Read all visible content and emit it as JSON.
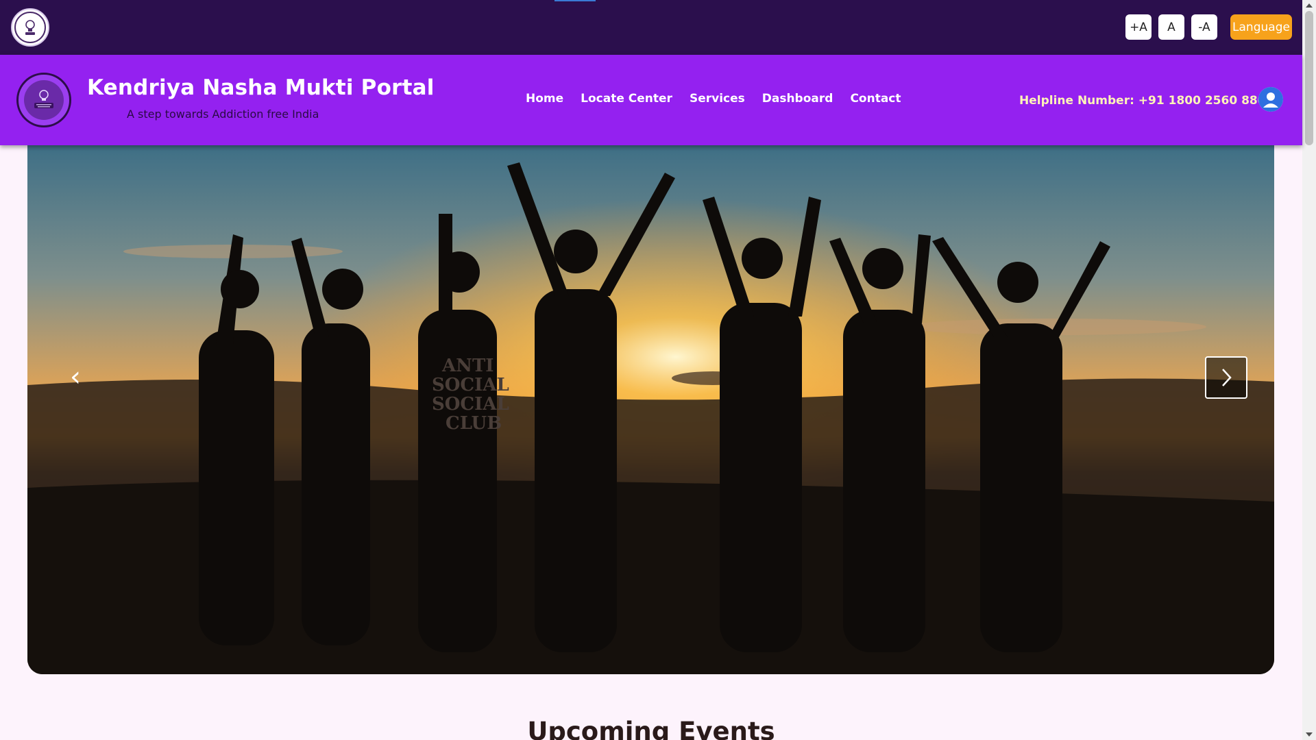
{
  "topbar": {
    "logo_icon": "emblem-logo-icon",
    "font_increase": "+A",
    "font_reset": "A",
    "font_decrease": "-A",
    "language_label": "Language"
  },
  "header": {
    "logo_icon": "portal-logo-icon",
    "title": "Kendriya Nasha Mukti Portal",
    "tagline": "A step towards Addiction free India",
    "nav": [
      "Home",
      "Locate Center",
      "Services",
      "Dashboard",
      "Contact"
    ],
    "helpline": "Helpline Number: +91 1800 2560 880",
    "user_icon": "user-avatar-icon"
  },
  "hero": {
    "image": "group raising hands at sunset",
    "prev_icon": "chevron-left-icon",
    "next_icon": "chevron-right-icon",
    "prev_glyph": "‹",
    "shirt_text": "ANTI SOCIAL SOCIAL CLUB"
  },
  "section": {
    "title": "Upcoming Events"
  },
  "colors": {
    "topbar": "#2b0f4d",
    "header": "#9421f0",
    "language_button": "#f7a21b",
    "helpline": "#fff4b8",
    "page_background": "#fdf3fc"
  }
}
